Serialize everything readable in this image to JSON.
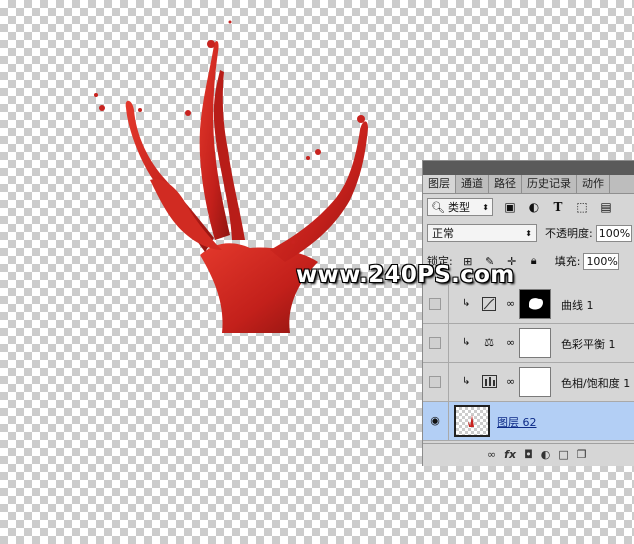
{
  "watermark": "www.240PS.com",
  "panel": {
    "tabs": [
      "图层",
      "通道",
      "路径",
      "历史记录",
      "动作"
    ],
    "filter_kind": "类型",
    "blend_mode": "正常",
    "opacity_label": "不透明度:",
    "opacity_value": "100%",
    "lock_label": "锁定:",
    "fill_label": "填充:",
    "fill_value": "100%",
    "layers": [
      {
        "name": "曲线 1",
        "type": "adjustment",
        "icon": "curves-icon",
        "mask": "black-with-white-shape",
        "visible": false
      },
      {
        "name": "色彩平衡 1",
        "type": "adjustment",
        "icon": "color-balance-icon",
        "mask": "white",
        "visible": false
      },
      {
        "name": "色相/饱和度 1",
        "type": "adjustment",
        "icon": "hue-saturation-icon",
        "mask": "white",
        "visible": false
      },
      {
        "name": "图层 62",
        "type": "pixel",
        "visible": true,
        "selected": true
      }
    ],
    "bottom_icons": [
      "link-icon",
      "fx-icon",
      "mask-icon",
      "adjustment-icon",
      "folder-icon",
      "new-layer-icon"
    ]
  },
  "colors": {
    "paint": "#c8231f",
    "selection": "#b3cff5",
    "panel_bg": "#d6d6d6"
  }
}
